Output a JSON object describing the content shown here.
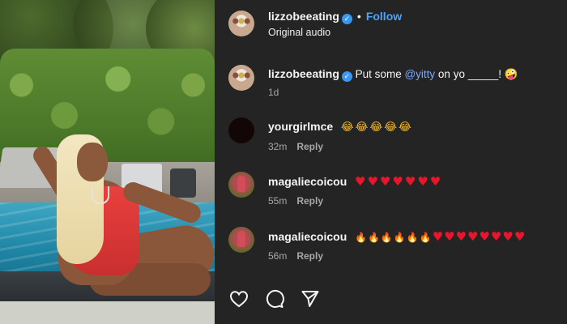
{
  "header": {
    "username": "lizzobeeating",
    "separator": "•",
    "follow_label": "Follow",
    "audio_label": "Original audio"
  },
  "caption": {
    "username": "lizzobeeating",
    "text_before": "Put some ",
    "mention": "@yitty",
    "text_after": " on yo _____! ",
    "emoji": "🤪",
    "age": "1d"
  },
  "comments": [
    {
      "username": "yourgirlmce",
      "emoji": "😂😂😂😂😂",
      "age": "32m",
      "reply_label": "Reply"
    },
    {
      "username": "magaliecoicou",
      "emoji": "♥♥♥♥♥♥♥",
      "age": "55m",
      "reply_label": "Reply"
    },
    {
      "username": "magaliecoicou",
      "fire": "🔥🔥🔥🔥🔥🔥",
      "hearts": "♥♥♥♥♥♥♥♥",
      "age": "56m",
      "reply_label": "Reply"
    }
  ],
  "actions": {
    "like_icon": "heart-outline-icon",
    "comment_icon": "comment-bubble-icon",
    "share_icon": "paper-plane-icon"
  },
  "colors": {
    "panel_bg": "#242424",
    "link_blue": "#4aa3ff",
    "verified_blue": "#3897f0",
    "muted_text": "#a8a8a8",
    "heart_red": "#e8152c"
  }
}
